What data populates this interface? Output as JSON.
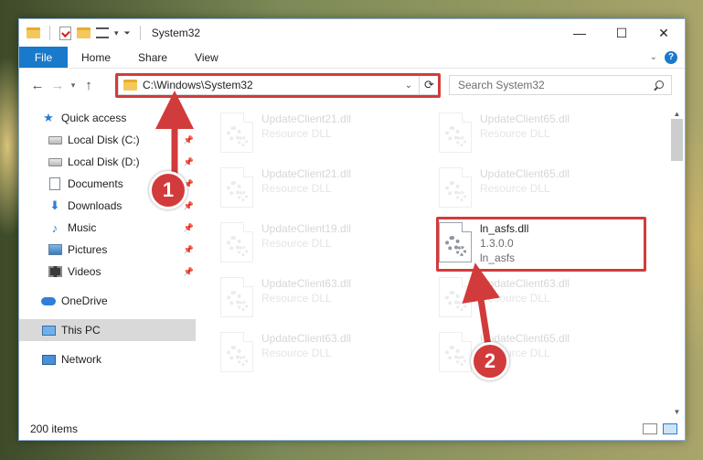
{
  "window": {
    "title": "System32"
  },
  "ribbon": {
    "tabs": [
      "File",
      "Home",
      "Share",
      "View"
    ]
  },
  "address": {
    "path": "C:\\Windows\\System32"
  },
  "search": {
    "placeholder": "Search System32"
  },
  "nav": {
    "items": [
      {
        "label": "Quick access",
        "icon": "star-icon",
        "pinned": false
      },
      {
        "label": "Local Disk (C:)",
        "icon": "drive-icon",
        "pinned": true
      },
      {
        "label": "Local Disk (D:)",
        "icon": "drive-icon",
        "pinned": true
      },
      {
        "label": "Documents",
        "icon": "documents-icon",
        "pinned": true
      },
      {
        "label": "Downloads",
        "icon": "downloads-icon",
        "pinned": true
      },
      {
        "label": "Music",
        "icon": "music-icon",
        "pinned": true
      },
      {
        "label": "Pictures",
        "icon": "pictures-icon",
        "pinned": true
      },
      {
        "label": "Videos",
        "icon": "videos-icon",
        "pinned": true
      },
      {
        "label": "OneDrive",
        "icon": "onedrive-icon",
        "pinned": false
      },
      {
        "label": "This PC",
        "icon": "this-pc-icon",
        "pinned": false,
        "selected": true
      },
      {
        "label": "Network",
        "icon": "network-icon",
        "pinned": false
      }
    ]
  },
  "files": [
    {
      "name": "UpdateClient21.dll",
      "type": "Resource DLL"
    },
    {
      "name": "UpdateClient65.dll",
      "type": "Resource DLL"
    },
    {
      "name": "UpdateClient21.dll",
      "type": "Resource DLL"
    },
    {
      "name": "UpdateClient65.dll",
      "type": "Resource DLL"
    },
    {
      "name": "UpdateClient19.dll",
      "type": "Resource DLL"
    },
    {
      "name": "ln_asfs.dll",
      "version": "1.3.0.0",
      "desc": "ln_asfs",
      "highlighted": true
    },
    {
      "name": "UpdateClient63.dll",
      "type": "Resource DLL"
    },
    {
      "name": "UpdateClient63.dll",
      "type": "Resource DLL"
    },
    {
      "name": "UpdateClient63.dll",
      "type": "Resource DLL"
    },
    {
      "name": "UpdateClient65.dll",
      "type": "Resource DLL"
    }
  ],
  "status": {
    "count": "200 items"
  },
  "annotations": {
    "step1": "1",
    "step2": "2"
  },
  "colors": {
    "accent": "#1979ca",
    "highlight": "#d23b3b"
  }
}
